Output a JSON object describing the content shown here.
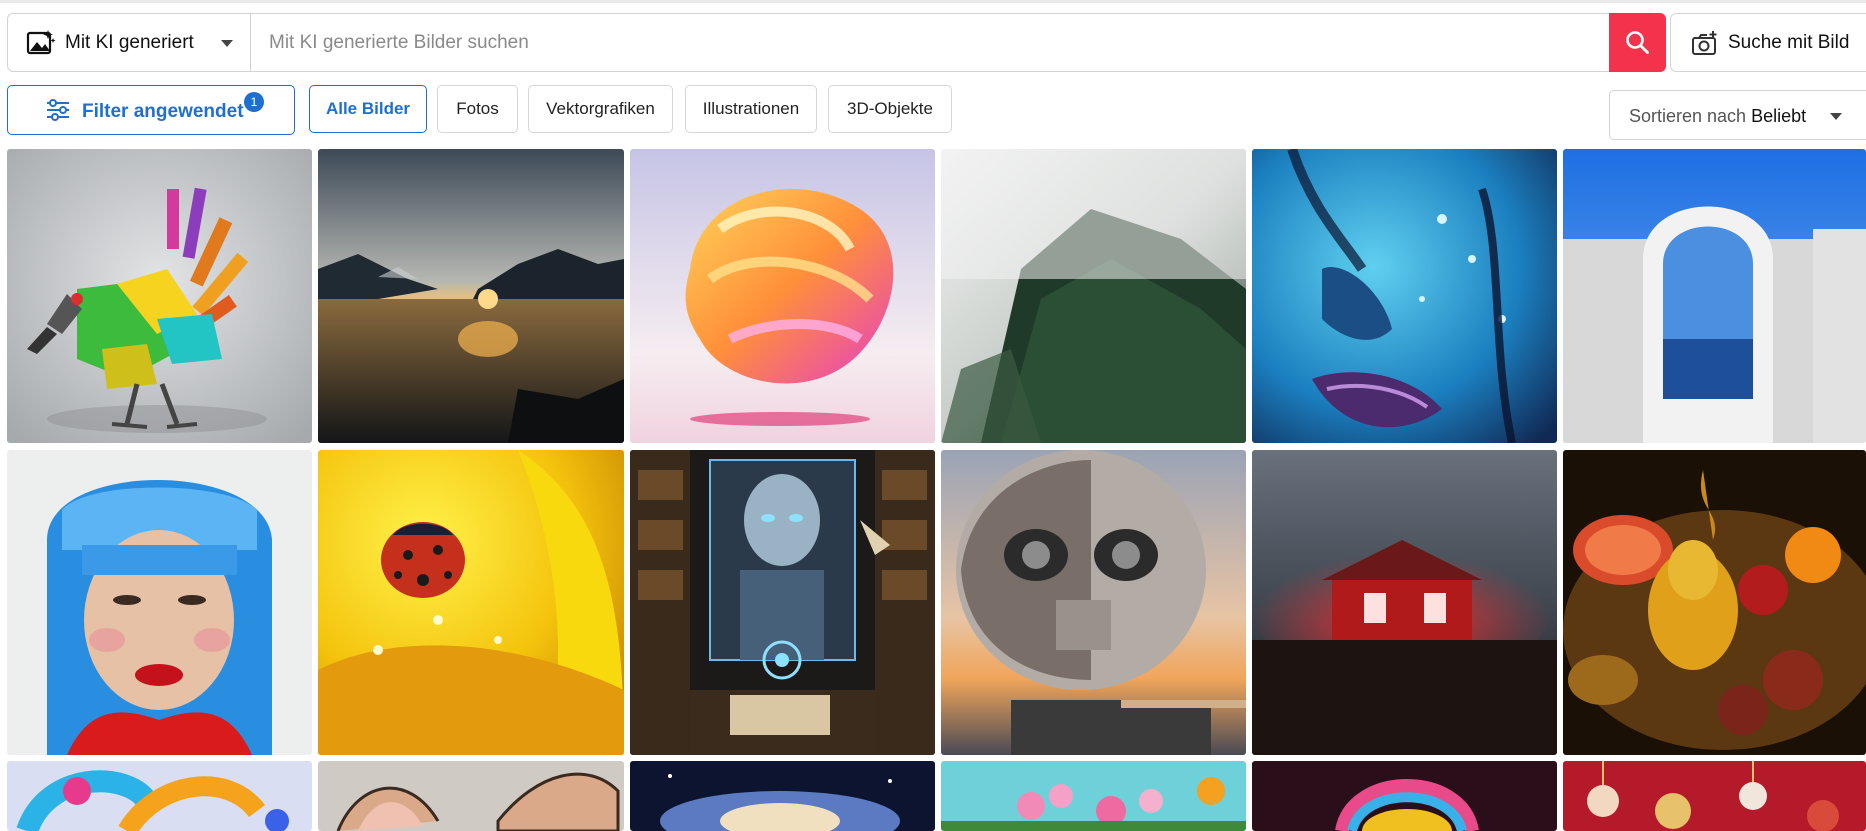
{
  "search": {
    "type_label": "Mit KI generiert",
    "placeholder": "Mit KI generierte Bilder suchen",
    "image_search_label": "Suche mit Bild"
  },
  "filters": {
    "filter_label": "Filter angewendet",
    "filter_count": "1",
    "tabs": [
      {
        "label": "Alle Bilder",
        "active": true
      },
      {
        "label": "Fotos",
        "active": false
      },
      {
        "label": "Vektorgrafiken",
        "active": false
      },
      {
        "label": "Illustrationen",
        "active": false
      },
      {
        "label": "3D-Objekte",
        "active": false
      }
    ],
    "sort_prefix": "Sortieren nach",
    "sort_value": "Beliebt"
  },
  "colors": {
    "accent_blue": "#1f6fd1",
    "search_red": "#f2334b"
  },
  "images": [
    {
      "name": "robot-bird-3d"
    },
    {
      "name": "mountain-lake-sunset"
    },
    {
      "name": "abstract-twisted-shape"
    },
    {
      "name": "misty-forest"
    },
    {
      "name": "blue-face-water-drops"
    },
    {
      "name": "white-arch-sea-view"
    },
    {
      "name": "woman-blue-hair-portrait"
    },
    {
      "name": "ladybug-yellow-flower"
    },
    {
      "name": "robot-library-writing"
    },
    {
      "name": "robot-head-sunset"
    },
    {
      "name": "red-glowing-house-fog"
    },
    {
      "name": "fruit-still-life"
    },
    {
      "name": "colorful-3d-tubes"
    },
    {
      "name": "animal-ears-illustration"
    },
    {
      "name": "cosmic-cloud"
    },
    {
      "name": "pink-flowers"
    },
    {
      "name": "headphones-colorful"
    },
    {
      "name": "christmas-ornaments"
    }
  ]
}
